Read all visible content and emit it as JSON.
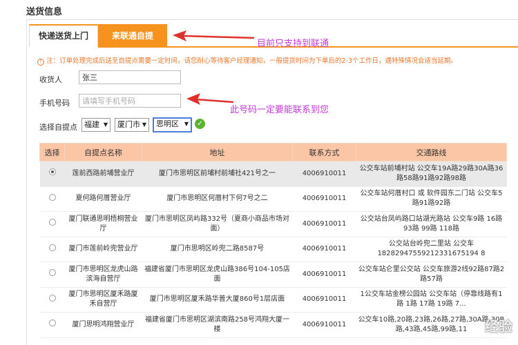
{
  "section_title": "送货信息",
  "tabs": [
    {
      "label": "快递送货上门",
      "active": true
    },
    {
      "label": "来联通自提",
      "active": false
    }
  ],
  "notice": "注：订单处理完成后送至自提点需要一定时间，请您耐心等待客户经理通知，一般提货时间为下单后的2-3个工作日，遇特殊情况会适当延期。",
  "form": {
    "recipient_label": "收货人",
    "recipient_value": "张三",
    "phone_label": "手机号码",
    "phone_placeholder": "请填写手机号码",
    "pickup_label": "选择自提点",
    "province": "福建",
    "city": "厦门市",
    "district": "思明区"
  },
  "annotations": {
    "tab_note": "目前只支持到联通",
    "phone_note": "此号码一定要能联系到您"
  },
  "table": {
    "headers": [
      "选择",
      "自提点名称",
      "地址",
      "联系方式",
      "交通路线"
    ],
    "rows": [
      {
        "selected": true,
        "name": "莲前西路前埔营业厅",
        "address": "厦门市思明区前埔村前埔社421号之一",
        "phone": "4006910011",
        "route": "公交车站前埔村站 公交车19A路29路30A路36路58路91路92路98路"
      },
      {
        "selected": false,
        "name": "夏何路何厝营业厅",
        "address": "厦门市思明区何厝村下何7号之二",
        "phone": "4006910011",
        "route": "公交车站何厝村口 或 软件园东二门站 公交车5路91路92路"
      },
      {
        "selected": false,
        "name": "厦门联通思明梧桐营业厅",
        "address": "厦门市思明区凤屿路332号（夏商小商品市场对面）",
        "phone": "4006910011",
        "route": "公交站台凤屿路口站湖光路站 公交车9路 16路 93路 99路 118路"
      },
      {
        "selected": false,
        "name": "厦门市莲前岭兜营业厅",
        "address": "厦门市思明区岭兜二路8587号",
        "phone": "4006910011",
        "route": "公交站台岭兜二里站 公交车18282947559212331675194 8"
      },
      {
        "selected": false,
        "name": "厦门市思明区龙虎山路滨海自营厅",
        "address": "福建省厦门市思明区龙虎山路386号104-105店面",
        "phone": "4006910011",
        "route": "公交车站仑里公交站 公交车旅游2线92路87路2路57路"
      },
      {
        "selected": false,
        "name": "厦门市思明区厦禾路厦禾自营厅",
        "address": "厦门市思明区厦禾路华普大厦860号1层店面",
        "phone": "4006910011",
        "route": "1公交车站金榜公园站 公交车站（停靠线路有1路 1路 17路 19路 7..."
      },
      {
        "selected": false,
        "name": "厦门思明鸿翔营业厅",
        "address": "福建省厦门市思明区湖滨南路258号鸿翔大厦一楼",
        "phone": "4006910011",
        "route": "公交车10路,20路,23路,26路,27路,30A路,30B路,43路,45路,99路,11"
      }
    ]
  },
  "watermark": "经验"
}
